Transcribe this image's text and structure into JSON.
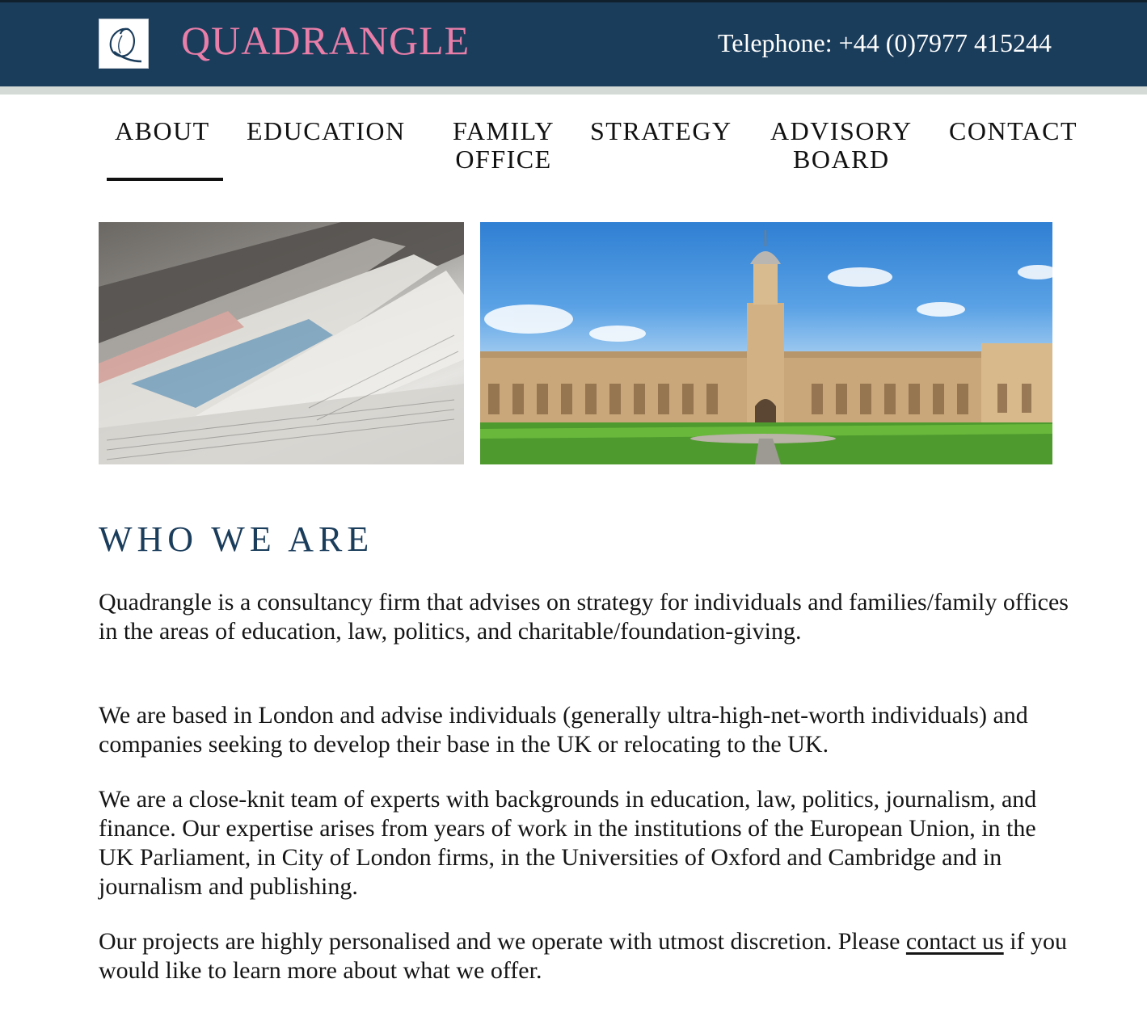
{
  "header": {
    "brand": "QUADRANGLE",
    "telephone": "Telephone: +44 (0)7977 415244",
    "logo_icon": "quadrangle-q-monogram-icon"
  },
  "nav": {
    "items": [
      {
        "label": "ABOUT",
        "active": true
      },
      {
        "label": "EDUCATION",
        "active": false
      },
      {
        "label": "FAMILY\nOFFICE",
        "active": false
      },
      {
        "label": "STRATEGY",
        "active": false
      },
      {
        "label": "ADVISORY\nBOARD",
        "active": false
      },
      {
        "label": "CONTACT",
        "active": false
      }
    ]
  },
  "main": {
    "heading": "WHO WE ARE",
    "p1": "Quadrangle is a consultancy firm that advises on strategy for individuals and families/family offices in the areas of education, law, politics, and charitable/foundation-giving.",
    "p2": "We are based in London and advise individuals (generally ultra-high-net-worth individuals) and companies seeking to develop their base in the UK or relocating to the UK.",
    "p3": "We are a close-knit team of experts with backgrounds in education, law, politics, journalism, and finance. Our expertise arises from years of work in the institutions of the European Union, in the UK Parliament, in City of London firms, in the Universities of Oxford and Cambridge and in journalism and publishing.",
    "p4_before": "Our projects are highly personalised and we operate with utmost discretion. Please ",
    "p4_link": "contact us",
    "p4_after": " if you would like to learn more about what we offer."
  },
  "colors": {
    "header_bg": "#1b3d5c",
    "brand_pink": "#e97ea8",
    "heading_blue": "#1b3d5c"
  }
}
